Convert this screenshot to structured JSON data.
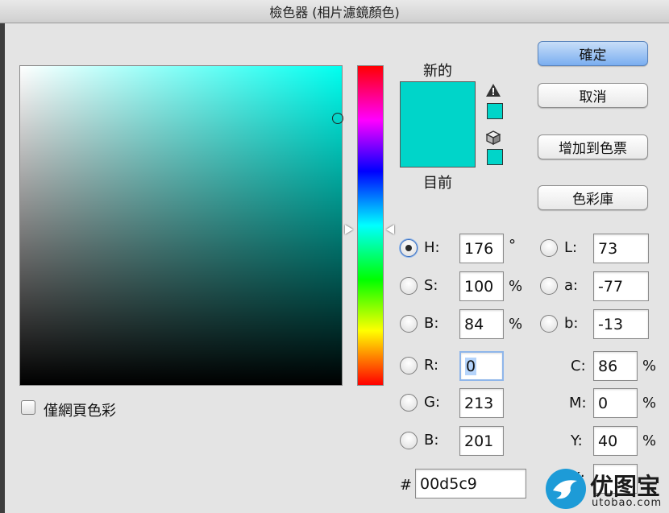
{
  "window": {
    "title": "檢色器 (相片濾鏡顏色)"
  },
  "swatches": {
    "new_label": "新的",
    "current_label": "目前",
    "new_color": "#00d5c9",
    "current_color": "#00d5c9",
    "gamut_icon": "warning-triangle-icon",
    "websafe_icon": "cube-icon"
  },
  "buttons": {
    "ok": "確定",
    "cancel": "取消",
    "add_to_swatches": "增加到色票",
    "color_libraries": "色彩庫"
  },
  "hsb": {
    "h_label": "H:",
    "h_value": "176",
    "h_unit": "°",
    "s_label": "S:",
    "s_value": "100",
    "s_unit": "%",
    "b_label": "B:",
    "b_value": "84",
    "b_unit": "%"
  },
  "lab": {
    "l_label": "L:",
    "l_value": "73",
    "a_label": "a:",
    "a_value": "-77",
    "b_label": "b:",
    "b_value": "-13"
  },
  "rgb": {
    "r_label": "R:",
    "r_value": "0",
    "g_label": "G:",
    "g_value": "213",
    "b_label": "B:",
    "b_value": "201"
  },
  "cmyk": {
    "c_label": "C:",
    "c_value": "86",
    "c_unit": "%",
    "m_label": "M:",
    "m_value": "0",
    "m_unit": "%",
    "y_label": "Y:",
    "y_value": "40",
    "y_unit": "%",
    "k_label": "K:"
  },
  "hex": {
    "label": "#",
    "value": "00d5c9"
  },
  "web_colors_checkbox": {
    "label": "僅網頁色彩",
    "checked": false
  },
  "watermark": {
    "text": "优图宝",
    "url_text": "utobao.com"
  },
  "accent_colors": {
    "ok_button": "#7aaef0",
    "selected_radio": "#3a6fc0"
  }
}
